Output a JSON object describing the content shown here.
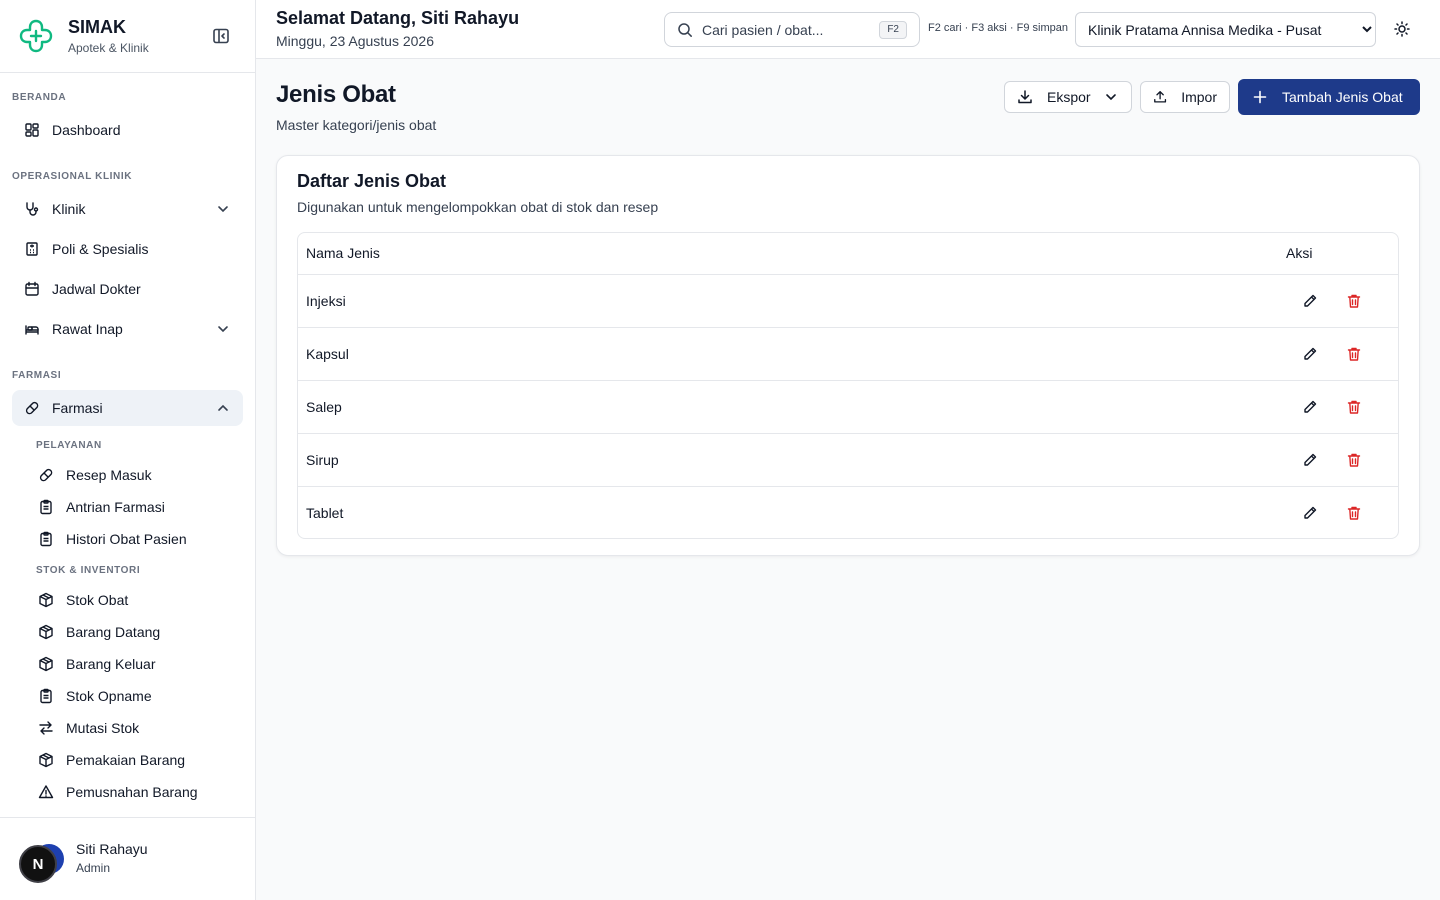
{
  "brand": {
    "name": "SIMAK",
    "subtitle": "Apotek & Klinik"
  },
  "sidebar": {
    "sections": {
      "beranda": "BERANDA",
      "operasional": "OPERASIONAL KLINIK",
      "farmasi": "FARMASI"
    },
    "items": {
      "dashboard": "Dashboard",
      "klinik": "Klinik",
      "poli": "Poli & Spesialis",
      "jadwal": "Jadwal Dokter",
      "rawat_inap": "Rawat Inap",
      "farmasi": "Farmasi"
    },
    "sub_sections": {
      "pelayanan": "PELAYANAN",
      "stok": "STOK & INVENTORI"
    },
    "sub_items": {
      "resep_masuk": "Resep Masuk",
      "antrian_farmasi": "Antrian Farmasi",
      "histori_obat": "Histori Obat Pasien",
      "stok_obat": "Stok Obat",
      "barang_datang": "Barang Datang",
      "barang_keluar": "Barang Keluar",
      "stok_opname": "Stok Opname",
      "mutasi_stok": "Mutasi Stok",
      "pemakaian_barang": "Pemakaian Barang",
      "pemusnahan_barang": "Pemusnahan Barang"
    }
  },
  "user": {
    "initial": "N",
    "name": "Siti Rahayu",
    "role": "Admin"
  },
  "header": {
    "greeting": "Selamat Datang, Siti Rahayu",
    "date": "Minggu, 23 Agustus 2026",
    "search_placeholder": "Cari pasien / obat...",
    "search_kbd": "F2",
    "shortcuts": "F2 cari · F3 aksi · F9 simpan",
    "clinic_selected": "Klinik Pratama Annisa Medika - Pusat"
  },
  "page": {
    "title": "Jenis Obat",
    "subtitle": "Master kategori/jenis obat",
    "export_label": "Ekspor",
    "import_label": "Impor",
    "add_label": "Tambah Jenis Obat"
  },
  "card": {
    "title": "Daftar Jenis Obat",
    "description": "Digunakan untuk mengelompokkan obat di stok dan resep",
    "columns": {
      "name": "Nama Jenis",
      "actions": "Aksi"
    },
    "rows": [
      "Injeksi",
      "Kapsul",
      "Salep",
      "Sirup",
      "Tablet"
    ]
  },
  "colors": {
    "primary": "#1e3a8a",
    "danger": "#dc2626",
    "brand_green": "#10b981"
  }
}
